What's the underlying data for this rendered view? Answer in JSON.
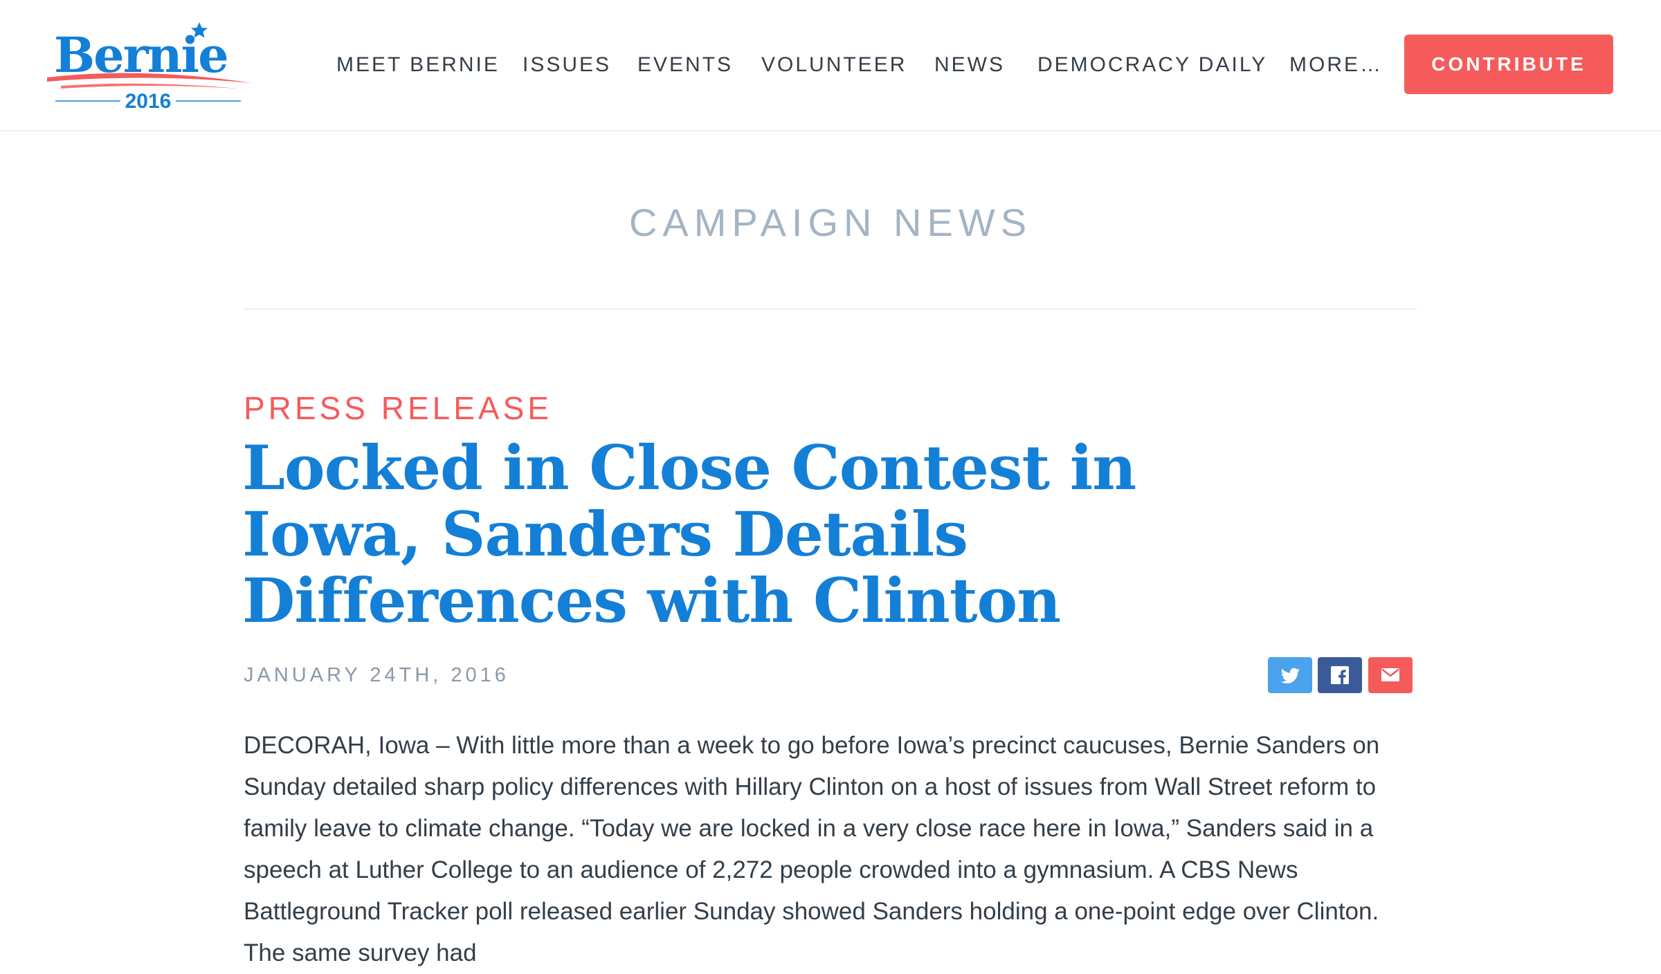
{
  "header": {
    "logo": {
      "wordmark": "Bernie",
      "year": "2016",
      "colors": {
        "blue": "#147fd7",
        "red": "#f55b5b"
      }
    },
    "nav": [
      {
        "label": "MEET BERNIE"
      },
      {
        "label": "ISSUES"
      },
      {
        "label": "EVENTS"
      },
      {
        "label": "VOLUNTEER"
      },
      {
        "label": "NEWS"
      },
      {
        "label": "DEMOCRACY DAILY"
      },
      {
        "label": "MORE…"
      }
    ],
    "contribute_label": "CONTRIBUTE"
  },
  "section": {
    "title": "CAMPAIGN NEWS"
  },
  "article": {
    "kicker": "PRESS RELEASE",
    "headline": "Locked in Close Contest in Iowa, Sanders Details Differences with Clinton",
    "date": "JANUARY 24TH, 2016",
    "share": [
      {
        "icon": "twitter-icon",
        "color": "#4aa3ec"
      },
      {
        "icon": "facebook-icon",
        "color": "#3b5a9a"
      },
      {
        "icon": "email-icon",
        "color": "#f55b5b"
      }
    ],
    "body": "DECORAH, Iowa – With little more than a week to go before Iowa’s precinct caucuses, Bernie Sanders on Sunday detailed sharp policy differences with Hillary Clinton on a host of issues from Wall Street reform to family leave to climate change. “Today we are locked in a very close race here in Iowa,” Sanders said in a speech at Luther College to an audience of 2,272 people crowded into a gymnasium. A CBS News Battleground Tracker poll released earlier Sunday showed Sanders holding a one-point edge over Clinton. The same survey had"
  },
  "colors": {
    "accent_red": "#f55b5b",
    "brand_blue": "#147fd7",
    "muted_title": "#a3b4c4",
    "text": "#333e48"
  }
}
